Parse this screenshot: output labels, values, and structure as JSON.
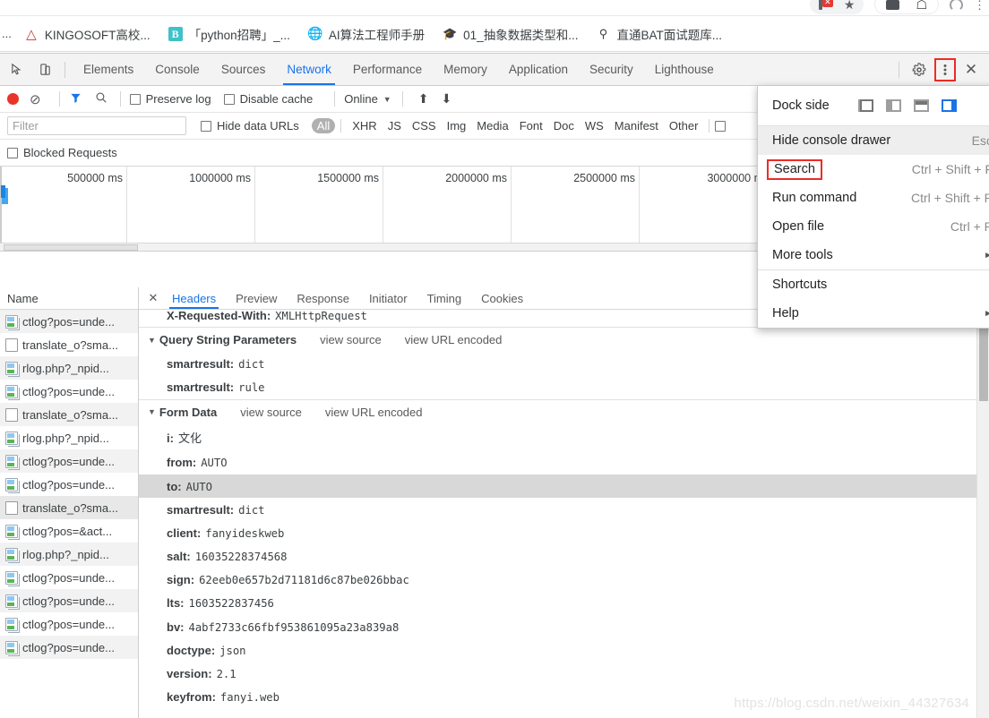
{
  "browser": {
    "bookmarks_ellipsis": "...",
    "bookmarks": [
      {
        "icon": "kingosoft-favicon",
        "label": "KINGOSOFT高校..."
      },
      {
        "icon": "bilibili-favicon",
        "label": "「python招聘」_..."
      },
      {
        "icon": "globe-favicon",
        "label": "AI算法工程师手册"
      },
      {
        "icon": "graduation-cap-favicon",
        "label": "01_抽象数据类型和..."
      },
      {
        "icon": "bat-favicon",
        "label": "直通BAT面试题库..."
      }
    ],
    "toolbar_icons": [
      "blocked-popup-icon",
      "bookmark-star-icon",
      "media-icon",
      "home-icon",
      "profile-icon",
      "more-vert-icon"
    ]
  },
  "devtools": {
    "left_buttons": [
      "inspect-element-icon",
      "device-toolbar-icon"
    ],
    "tabs": [
      {
        "label": "Elements",
        "active": false
      },
      {
        "label": "Console",
        "active": false
      },
      {
        "label": "Sources",
        "active": false
      },
      {
        "label": "Network",
        "active": true
      },
      {
        "label": "Performance",
        "active": false
      },
      {
        "label": "Memory",
        "active": false
      },
      {
        "label": "Application",
        "active": false
      },
      {
        "label": "Security",
        "active": false
      },
      {
        "label": "Lighthouse",
        "active": false
      }
    ],
    "right_buttons": [
      "settings-gear-icon",
      "more-options-icon",
      "close-devtools-icon"
    ],
    "network_toolbar": {
      "record_title": "record-button",
      "clear_title": "clear-button",
      "filter_title": "filter-button",
      "search_title": "search-button",
      "preserve_log": "Preserve log",
      "disable_cache": "Disable cache",
      "throttling": "Online",
      "import_title": "import-har-icon",
      "export_title": "export-har-icon"
    },
    "filter_row": {
      "placeholder": "Filter",
      "value": "",
      "hide_data_urls": "Hide data URLs",
      "types": [
        "All",
        "XHR",
        "JS",
        "CSS",
        "Img",
        "Media",
        "Font",
        "Doc",
        "WS",
        "Manifest",
        "Other"
      ],
      "selected_type": "All"
    },
    "blocked_requests": "Blocked Requests",
    "overview": {
      "ticks": [
        "500000 ms",
        "1000000 ms",
        "1500000 ms",
        "2000000 ms",
        "2500000 ms",
        "3000000 m"
      ]
    },
    "request_list": {
      "header": "Name",
      "rows": [
        {
          "icon": "image-file-icon",
          "name": "ctlog?pos=unde..."
        },
        {
          "icon": "doc-file-icon",
          "name": "translate_o?sma..."
        },
        {
          "icon": "image-file-icon",
          "name": "rlog.php?_npid..."
        },
        {
          "icon": "image-file-icon",
          "name": "ctlog?pos=unde..."
        },
        {
          "icon": "doc-file-icon",
          "name": "translate_o?sma..."
        },
        {
          "icon": "image-file-icon",
          "name": "rlog.php?_npid..."
        },
        {
          "icon": "image-file-icon",
          "name": "ctlog?pos=unde..."
        },
        {
          "icon": "image-file-icon",
          "name": "ctlog?pos=unde..."
        },
        {
          "icon": "doc-file-icon",
          "name": "translate_o?sma..."
        },
        {
          "icon": "image-file-icon",
          "name": "ctlog?pos=&act..."
        },
        {
          "icon": "image-file-icon",
          "name": "rlog.php?_npid..."
        },
        {
          "icon": "image-file-icon",
          "name": "ctlog?pos=unde..."
        },
        {
          "icon": "image-file-icon",
          "name": "ctlog?pos=unde..."
        },
        {
          "icon": "image-file-icon",
          "name": "ctlog?pos=unde..."
        },
        {
          "icon": "image-file-icon",
          "name": "ctlog?pos=unde..."
        }
      ],
      "selected_index": 8
    },
    "detail": {
      "tabs": [
        {
          "label": "Headers",
          "active": true
        },
        {
          "label": "Preview",
          "active": false
        },
        {
          "label": "Response",
          "active": false
        },
        {
          "label": "Initiator",
          "active": false
        },
        {
          "label": "Timing",
          "active": false
        },
        {
          "label": "Cookies",
          "active": false
        }
      ],
      "clipped_header": {
        "key": "X-Requested-With:",
        "value": "XMLHttpRequest"
      },
      "query_section": {
        "title": "Query String Parameters",
        "view_source": "view source",
        "view_url_encoded": "view URL encoded",
        "params": [
          {
            "key": "smartresult:",
            "value": "dict"
          },
          {
            "key": "smartresult:",
            "value": "rule"
          }
        ]
      },
      "form_section": {
        "title": "Form Data",
        "view_source": "view source",
        "view_url_encoded": "view URL encoded",
        "params": [
          {
            "key": "i:",
            "value": "文化",
            "cjk": true
          },
          {
            "key": "from:",
            "value": "AUTO"
          },
          {
            "key": "to:",
            "value": "AUTO",
            "highlight": true
          },
          {
            "key": "smartresult:",
            "value": "dict"
          },
          {
            "key": "client:",
            "value": "fanyideskweb"
          },
          {
            "key": "salt:",
            "value": "16035228374568"
          },
          {
            "key": "sign:",
            "value": "62eeb0e657b2d71181d6c87be026bbac"
          },
          {
            "key": "lts:",
            "value": "1603522837456"
          },
          {
            "key": "bv:",
            "value": "4abf2733c66fbf953861095a23a839a8"
          },
          {
            "key": "doctype:",
            "value": "json"
          },
          {
            "key": "version:",
            "value": "2.1"
          },
          {
            "key": "keyfrom:",
            "value": "fanyi.web"
          }
        ]
      }
    }
  },
  "menu": {
    "dock_label": "Dock side",
    "dock_options": [
      "undock-into-separate-window",
      "dock-to-left",
      "dock-to-bottom",
      "dock-to-right"
    ],
    "dock_selected": "dock-to-right",
    "items": [
      {
        "label": "Hide console drawer",
        "shortcut": "Esc",
        "hover": true,
        "boxed": false,
        "submenu": false
      },
      {
        "label": "Search",
        "shortcut": "Ctrl + Shift + F",
        "hover": false,
        "boxed": true,
        "submenu": false
      },
      {
        "label": "Run command",
        "shortcut": "Ctrl + Shift + P",
        "hover": false,
        "boxed": false,
        "submenu": false
      },
      {
        "label": "Open file",
        "shortcut": "Ctrl + P",
        "hover": false,
        "boxed": false,
        "submenu": false
      },
      {
        "label": "More tools",
        "shortcut": "",
        "hover": false,
        "boxed": false,
        "submenu": true
      },
      {
        "label": "Shortcuts",
        "shortcut": "",
        "hover": false,
        "boxed": false,
        "submenu": false
      },
      {
        "label": "Help",
        "shortcut": "",
        "hover": false,
        "boxed": false,
        "submenu": true
      }
    ]
  },
  "watermark": "https://blog.csdn.net/weixin_44327634",
  "colors": {
    "accent": "#1a73e8",
    "record": "#e8342a",
    "highlight_box": "#ee2b26",
    "bookmark_bilibili": "#3fc1c9"
  }
}
